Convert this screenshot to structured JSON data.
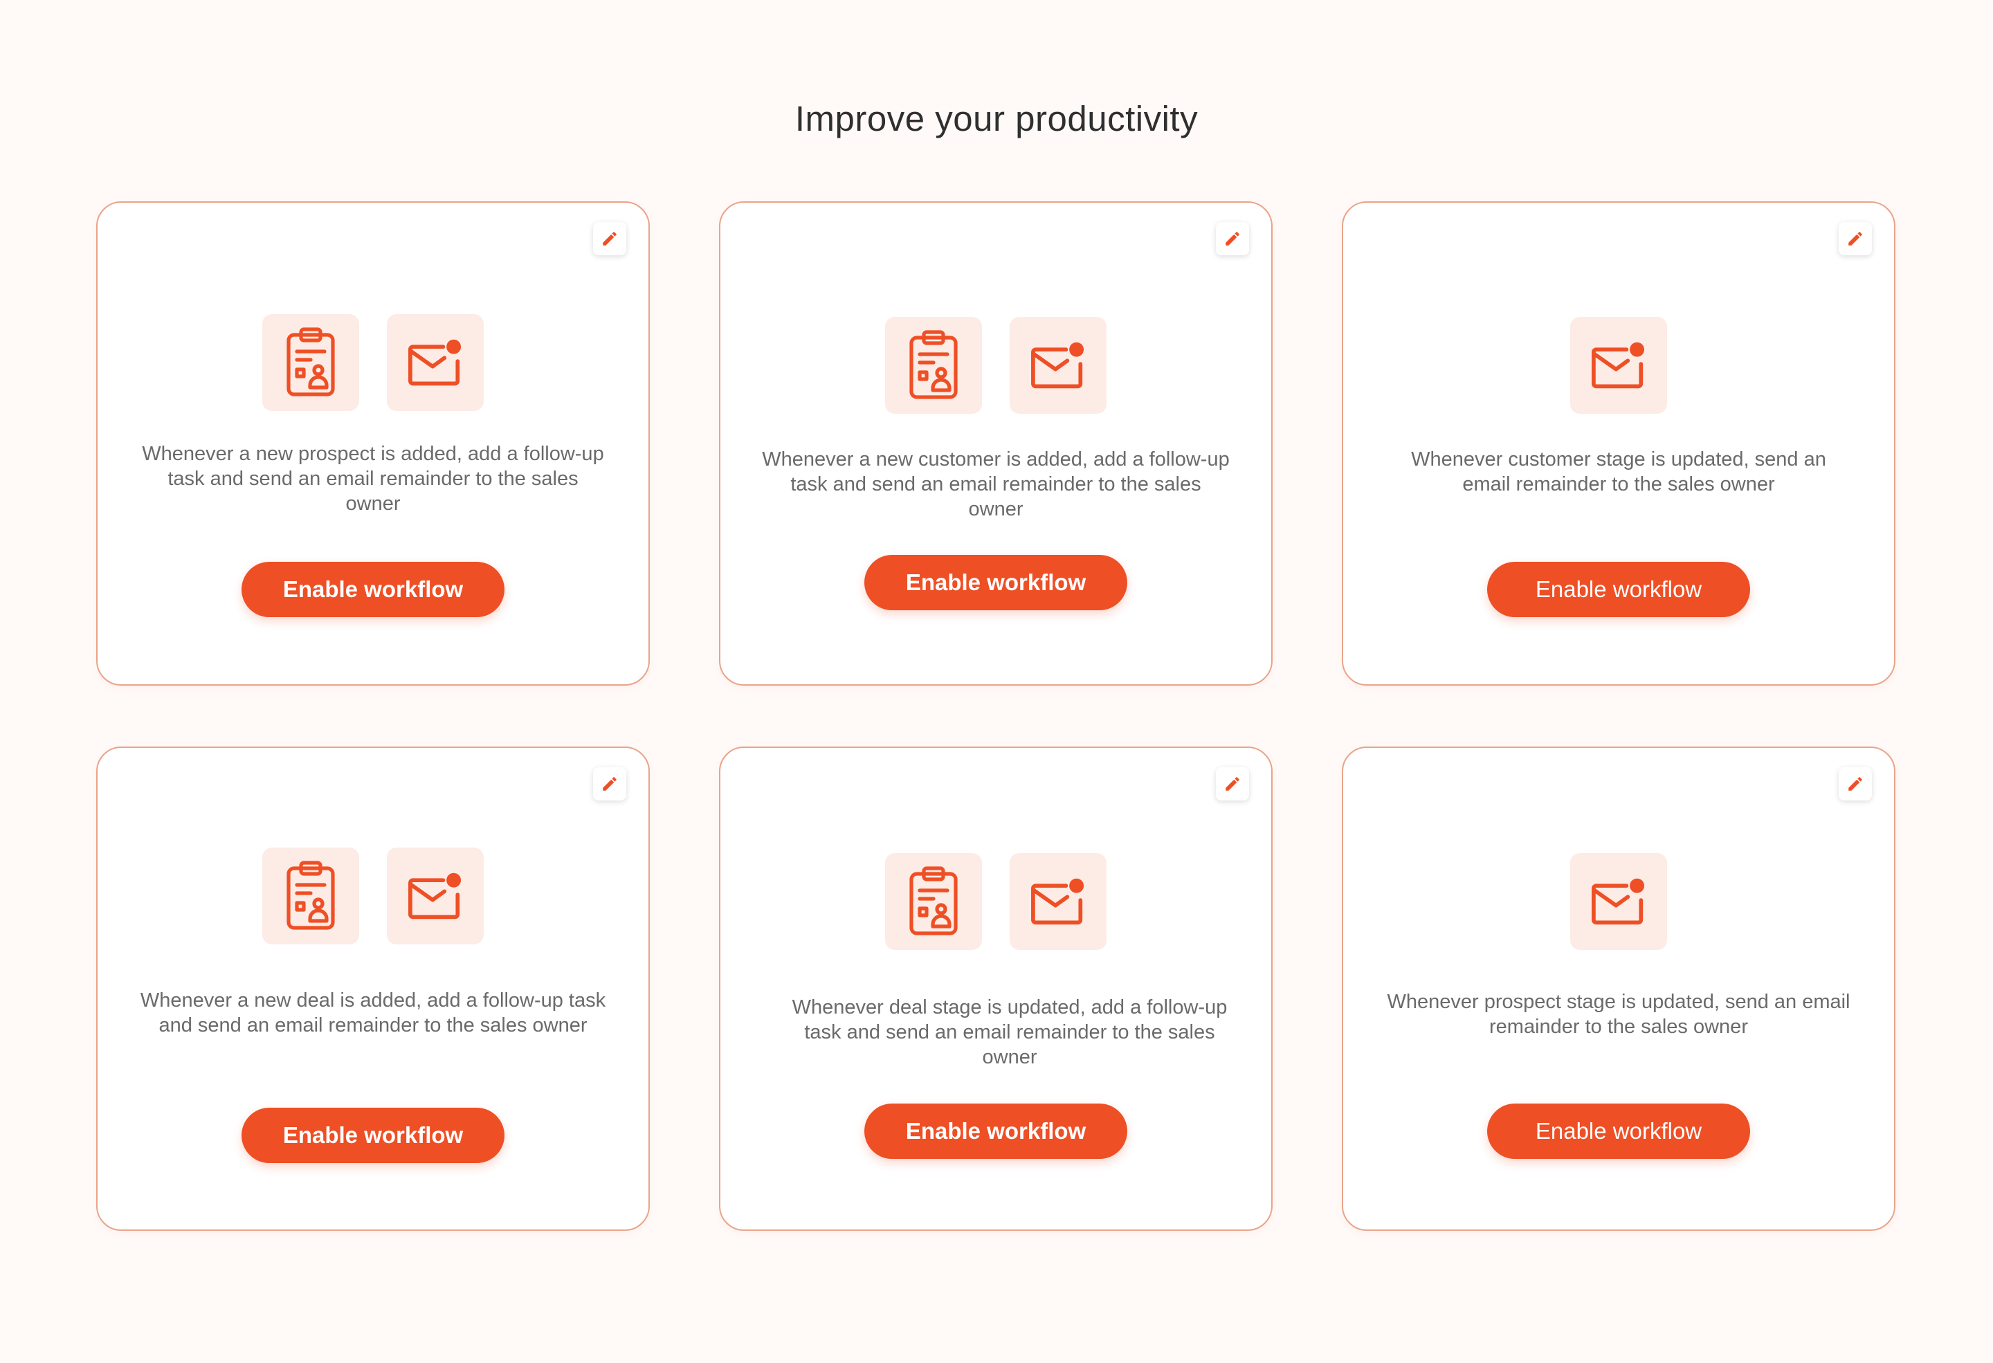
{
  "page": {
    "title": "Improve your productivity"
  },
  "colors": {
    "accent": "#ee4f25",
    "icon_tile_bg": "#fdebe5",
    "card_border": "#e9a48a",
    "page_bg": "#fffaf8"
  },
  "icons": {
    "edit": "pencil-icon",
    "task": "clipboard-task-icon",
    "email": "email-notification-icon"
  },
  "cards": [
    {
      "description": "Whenever a new prospect is added, add a follow-up task and send an email remainder to the sales owner",
      "button_label": "Enable workflow",
      "icons": [
        "clipboard-task-icon",
        "email-notification-icon"
      ]
    },
    {
      "description": "Whenever a new customer is added, add a follow-up task and send an email remainder to the sales owner",
      "button_label": "Enable workflow",
      "icons": [
        "clipboard-task-icon",
        "email-notification-icon"
      ]
    },
    {
      "description": "Whenever customer stage is updated, send an email remainder to the sales owner",
      "button_label": "Enable workflow",
      "icons": [
        "email-notification-icon"
      ]
    },
    {
      "description": "Whenever a new deal is added, add a follow-up task and send an email remainder to the sales owner",
      "button_label": "Enable workflow",
      "icons": [
        "clipboard-task-icon",
        "email-notification-icon"
      ]
    },
    {
      "description": "Whenever deal stage is updated, add a follow-up task and send an email remainder to the sales owner",
      "button_label": "Enable workflow",
      "icons": [
        "clipboard-task-icon",
        "email-notification-icon"
      ]
    },
    {
      "description": "Whenever prospect stage is updated, send an email remainder to the sales owner",
      "button_label": "Enable workflow",
      "icons": [
        "email-notification-icon"
      ]
    }
  ]
}
